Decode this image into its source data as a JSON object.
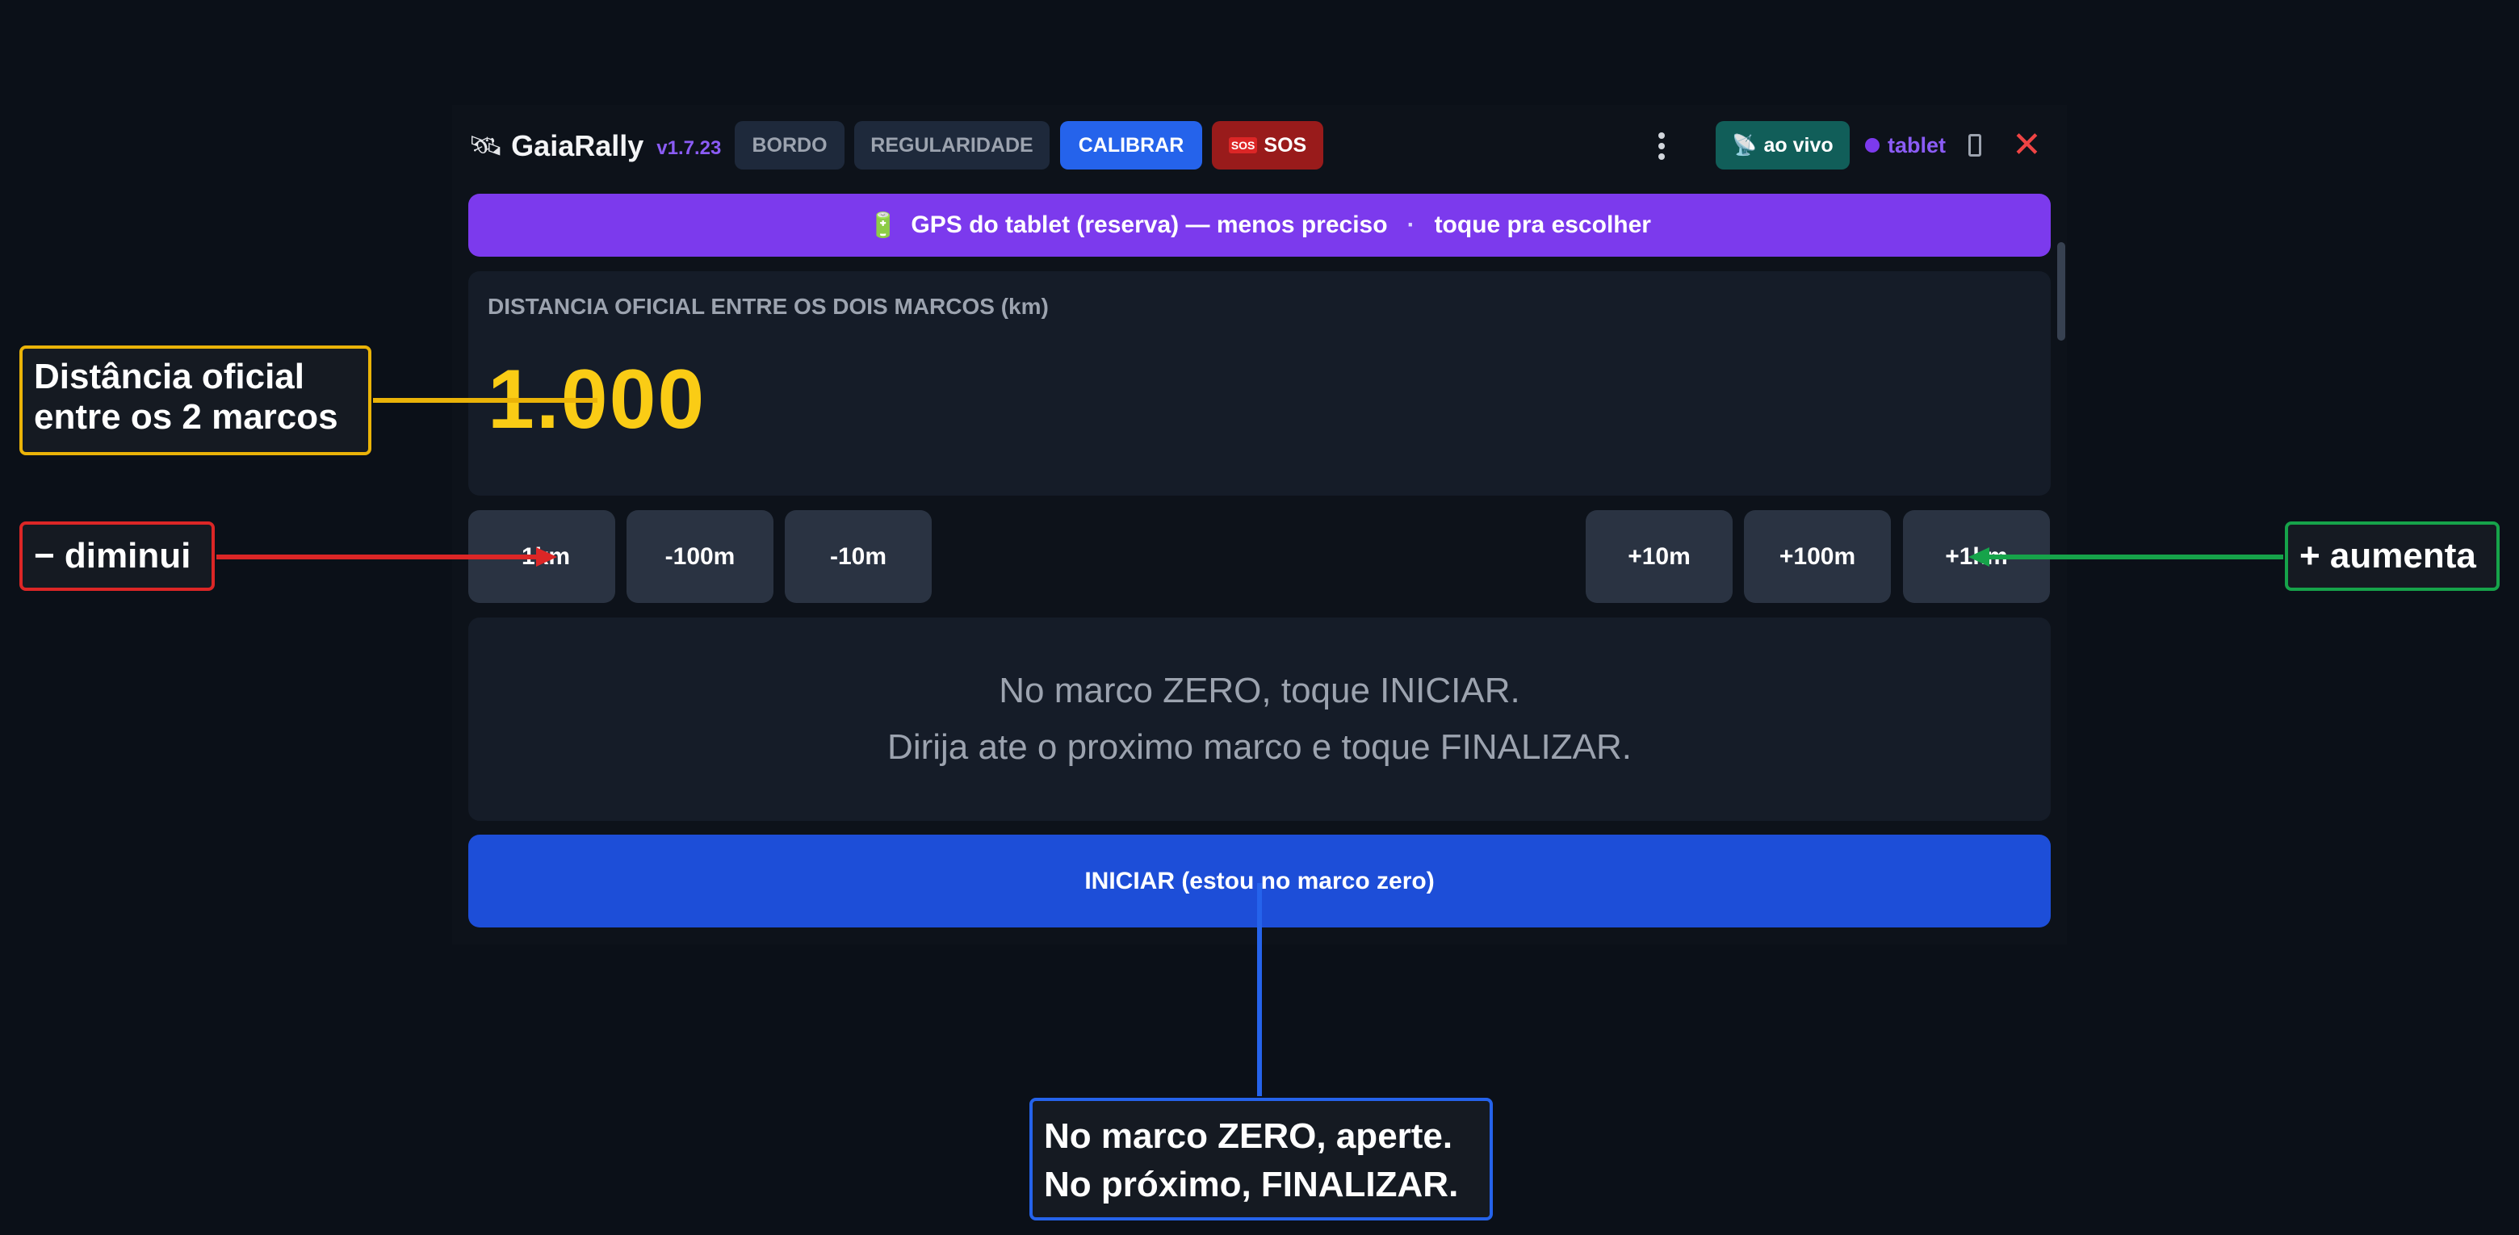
{
  "header": {
    "brand_icon": "satellite-icon",
    "app_name": "GaiaRally",
    "version": "v1.7.23",
    "tabs": [
      {
        "label": "BORDO"
      },
      {
        "label": "REGULARIDADE"
      },
      {
        "label": "CALIBRAR"
      },
      {
        "label": "SOS",
        "icon": "sos-icon"
      }
    ],
    "live_label": "ao vivo",
    "device_label": "tablet"
  },
  "gps_banner": {
    "text": "GPS do tablet (reserva) — menos preciso",
    "separator": "·",
    "action": "toque pra escolher"
  },
  "distance": {
    "label": "DISTANCIA OFICIAL ENTRE OS DOIS MARCOS (km)",
    "value": "1.000"
  },
  "steps": {
    "minus": [
      "-1km",
      "-100m",
      "-10m"
    ],
    "plus": [
      "+10m",
      "+100m",
      "+1km"
    ]
  },
  "message": {
    "line1": "No marco ZERO, toque INICIAR.",
    "line2": "Dirija ate o proximo marco e toque FINALIZAR."
  },
  "start_button": "INICIAR (estou no marco zero)",
  "annotations": {
    "distance_line1": "Distância oficial",
    "distance_line2": "entre os 2 marcos",
    "decrease": "− diminui",
    "increase": "+ aumenta",
    "start_line1": "No marco ZERO, aperte.",
    "start_line2": "No próximo, FINALIZAR."
  },
  "colors": {
    "accent_purple": "#7c3aed",
    "primary_blue": "#1d4ed8",
    "distance_yellow": "#facc15",
    "annotation_red": "#dc2626",
    "annotation_green": "#16a34a",
    "annotation_yellow": "#eab308"
  }
}
